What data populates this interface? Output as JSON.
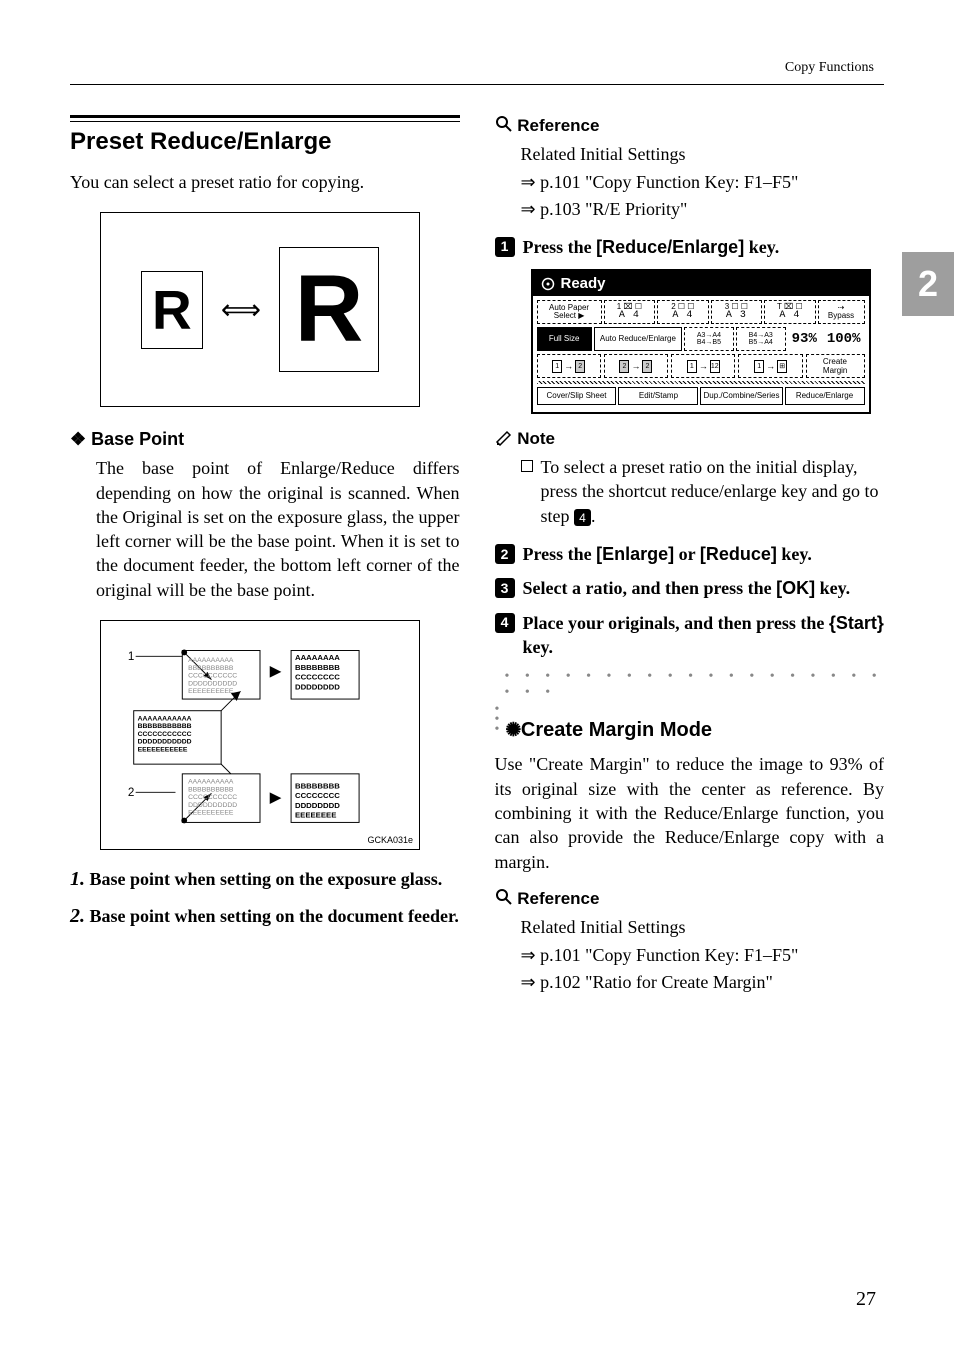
{
  "header": {
    "section": "Copy Functions"
  },
  "sideTab": "2",
  "pageNumber": "27",
  "left": {
    "title": "Preset Reduce/Enlarge",
    "intro": "You can select a preset ratio for copying.",
    "rGlyph": "R",
    "basePoint": {
      "heading": "Base Point",
      "text": "The base point of Enlarge/Reduce differs depending on how the original is scanned. When the Original is set on the exposure glass, the upper left corner will be the base point. When it is set to the document feeder, the bottom left corner of the original will be the base point.",
      "figLabel1": "1",
      "figLabel2": "2",
      "figCaption": "GCKA031e"
    },
    "defs": [
      {
        "num": "1.",
        "text": "Base point when setting on the exposure glass."
      },
      {
        "num": "2.",
        "text": "Base point when setting on the document feeder."
      }
    ]
  },
  "right": {
    "reference1": {
      "heading": "Reference",
      "lead": "Related Initial Settings",
      "items": [
        "p.101 \"Copy Function Key: F1–F5\"",
        "p.103 \"R/E Priority\""
      ]
    },
    "step1": {
      "pre": "Press the ",
      "key": "[Reduce/Enlarge]",
      "post": " key."
    },
    "lcd": {
      "ready": "Ready",
      "row1": {
        "autoPaper": "Auto Paper\nSelect ▶",
        "t1": {
          "top": "1 ⌧ ☐",
          "sz": "A 4"
        },
        "t2": {
          "top": "2 ☐ ☐",
          "sz": "A 4"
        },
        "t3": {
          "top": "3 ☐ ☐",
          "sz": "A 3"
        },
        "t4": {
          "top": "T ⌧ ☐",
          "sz": "A 4"
        },
        "bypass": "⇢\nBypass"
      },
      "row2": {
        "fullsize": "Full Size",
        "auto": "Auto Reduce/Enlarge",
        "r1": "A3→A4\nB4→B5",
        "r2": "B4→A3\nB5→A4",
        "pct1": "93%",
        "pct2": "100%"
      },
      "row3": {
        "createMargin": "Create\nMargin"
      },
      "row4": {
        "b1": "Cover/Slip Sheet",
        "b2": "Edit/Stamp",
        "b3": "Dup./Combine/Series",
        "b4": "Reduce/Enlarge"
      }
    },
    "note": {
      "heading": "Note",
      "text_a": "To select a preset ratio on the initial display, press the shortcut reduce/enlarge key and go to step ",
      "stepRef": "4",
      "text_b": "."
    },
    "step2": {
      "pre": "Press the ",
      "key1": "[Enlarge]",
      "mid": " or ",
      "key2": "[Reduce]",
      "post": " key."
    },
    "step3": {
      "pre": "Select a ratio, and then press the ",
      "key": "[OK]",
      "post": " key."
    },
    "step4": {
      "pre": "Place your originals, and then press the ",
      "key": "{Start}",
      "post": " key."
    },
    "createMargin": {
      "heading": "Create Margin Mode",
      "body": "Use \"Create Margin\" to reduce the image to 93% of its original size with the center as reference. By combining it with the Reduce/Enlarge function, you can also provide the Reduce/Enlarge copy with a margin."
    },
    "reference2": {
      "heading": "Reference",
      "lead": "Related Initial Settings",
      "items": [
        "p.101 \"Copy Function Key: F1–F5\"",
        "p.102 \"Ratio for Create Margin\""
      ]
    }
  }
}
